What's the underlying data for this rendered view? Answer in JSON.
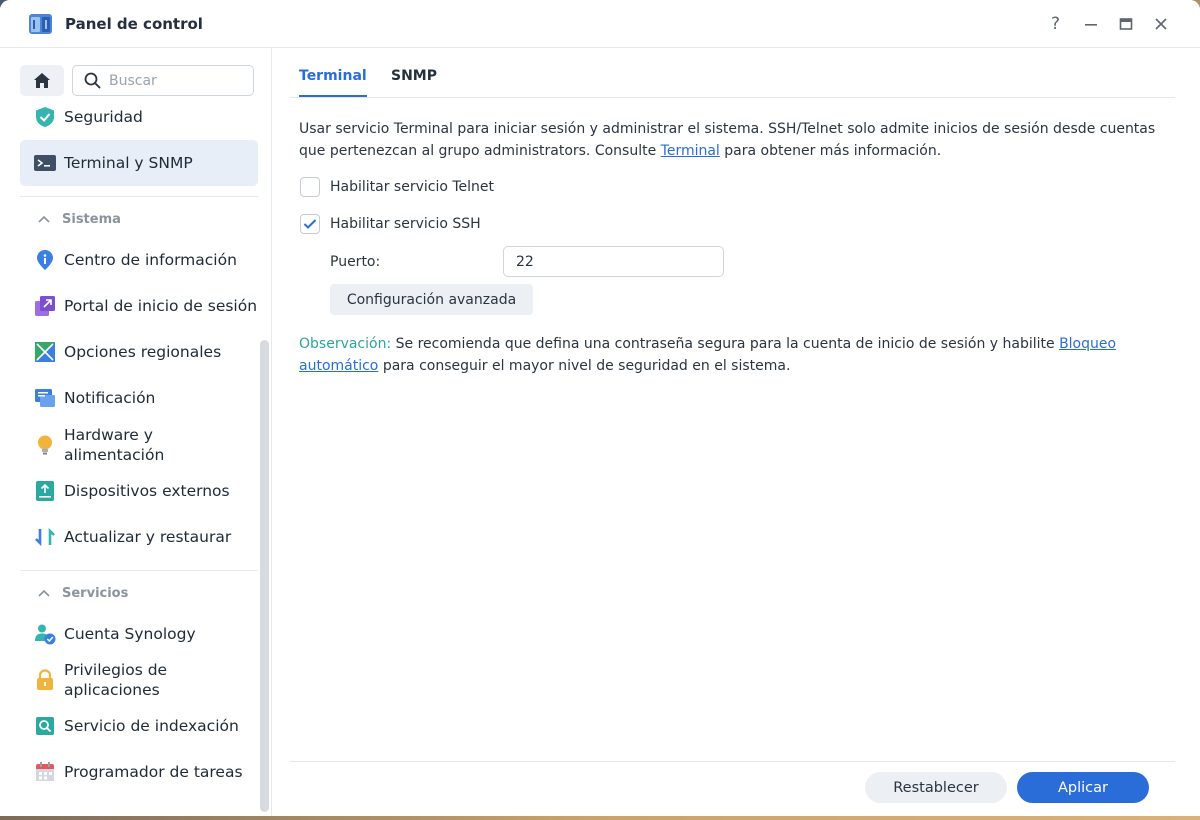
{
  "window": {
    "title": "Panel de control",
    "help_label": "?"
  },
  "sidebar": {
    "search_placeholder": "Buscar",
    "items_top": [
      {
        "label": "Seguridad",
        "icon": "shield-icon"
      },
      {
        "label": "Terminal y SNMP",
        "icon": "terminal-icon",
        "active": true
      }
    ],
    "section_sistema": {
      "label": "Sistema",
      "items": [
        {
          "label": "Centro de información",
          "icon": "info-icon"
        },
        {
          "label": "Portal de inicio de sesión",
          "icon": "login-portal-icon"
        },
        {
          "label": "Opciones regionales",
          "icon": "regional-icon"
        },
        {
          "label": "Notificación",
          "icon": "notification-icon"
        },
        {
          "label": "Hardware y alimentación",
          "icon": "lightbulb-icon"
        },
        {
          "label": "Dispositivos externos",
          "icon": "external-device-icon"
        },
        {
          "label": "Actualizar y restaurar",
          "icon": "update-icon"
        }
      ]
    },
    "section_servicios": {
      "label": "Servicios",
      "items": [
        {
          "label": "Cuenta Synology",
          "icon": "account-icon"
        },
        {
          "label": "Privilegios de aplicaciones",
          "icon": "lock-icon"
        },
        {
          "label": "Servicio de indexación",
          "icon": "indexing-icon"
        },
        {
          "label": "Programador de tareas",
          "icon": "calendar-icon"
        }
      ]
    }
  },
  "tabs": [
    {
      "label": "Terminal",
      "active": true
    },
    {
      "label": "SNMP",
      "active": false
    }
  ],
  "main": {
    "description_part1": "Usar servicio Terminal para iniciar sesión y administrar el sistema. SSH/Telnet solo admite inicios de sesión desde cuentas que pertenezcan al grupo administrators. Consulte ",
    "description_link": "Terminal",
    "description_part2": " para obtener más información.",
    "telnet_label": "Habilitar servicio Telnet",
    "telnet_checked": false,
    "ssh_label": "Habilitar servicio SSH",
    "ssh_checked": true,
    "port_label": "Puerto:",
    "port_value": "22",
    "advanced_button": "Configuración avanzada",
    "note_label": "Observación:",
    "note_part1": " Se recomienda que defina una contraseña segura para la cuenta de inicio de sesión y habilite ",
    "note_link": "Bloqueo automático",
    "note_part2": " para conseguir el mayor nivel de seguridad en el sistema."
  },
  "footer": {
    "reset_label": "Restablecer",
    "apply_label": "Aplicar"
  },
  "colors": {
    "accent": "#2a6dd9",
    "note_accent": "#2ba59a",
    "active_item_bg": "#e8eef7"
  }
}
